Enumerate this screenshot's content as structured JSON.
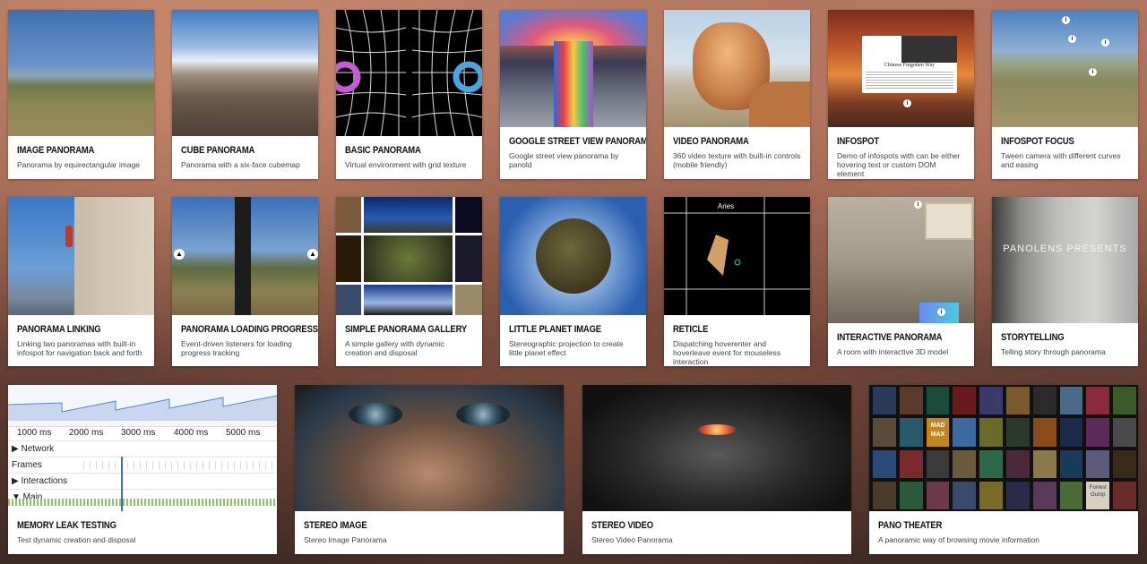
{
  "cards": [
    {
      "title": "IMAGE PANORAMA",
      "desc": "Panorama by equirectangular image"
    },
    {
      "title": "CUBE PANORAMA",
      "desc": "Panorama with a six-face cubemap"
    },
    {
      "title": "BASIC PANORAMA",
      "desc": "Virtual environment with grid texture"
    },
    {
      "title": "GOOGLE STREET VIEW PANORAMA",
      "desc": "Google street view panorama by panold"
    },
    {
      "title": "VIDEO PANORAMA",
      "desc": "360 video texture with built-in controls (mobile friendly)"
    },
    {
      "title": "INFOSPOT",
      "desc": "Demo of infospots with can be either hovering text or custom DOM element"
    },
    {
      "title": "INFOSPOT FOCUS",
      "desc": "Tween camera with different curves and easing"
    },
    {
      "title": "PANORAMA LINKING",
      "desc": "Linking two panoramas with built-in infospot for navigation back and forth"
    },
    {
      "title": "PANORAMA LOADING PROGRESS",
      "desc": "Event-driven listeners for loading progress tracking"
    },
    {
      "title": "SIMPLE PANORAMA GALLERY",
      "desc": "A simple gallery with dynamic creation and disposal"
    },
    {
      "title": "LITTLE PLANET IMAGE",
      "desc": "Stereographic projection to create little planet effect"
    },
    {
      "title": "RETICLE",
      "desc": "Dispatching hoverenter and hoverleave event for mouseless interaction"
    },
    {
      "title": "INTERACTIVE PANORAMA",
      "desc": "A room with interactive 3D model"
    },
    {
      "title": "STORYTELLING",
      "desc": "Telling story through panorama"
    },
    {
      "title": "MEMORY LEAK TESTING",
      "desc": "Test dynamic creation and disposal"
    },
    {
      "title": "STEREO IMAGE",
      "desc": "Stereo Image Panorama"
    },
    {
      "title": "STEREO VIDEO",
      "desc": "Stereo Video Panorama"
    },
    {
      "title": "PANO THEATER",
      "desc": "A panoramic way of browsing movie information"
    }
  ],
  "thumb_text": {
    "infospot_heading": "Chinese Forgotten Way",
    "reticle_label": "Aries",
    "storytelling_overlay": "PANOLENS PRESENTS",
    "poster_label": "MAD MAX",
    "poster_label_2": "Forrest Gump"
  },
  "perf": {
    "ticks": [
      "1000 ms",
      "2000 ms",
      "3000 ms",
      "4000 ms",
      "5000 ms"
    ],
    "rows": [
      "▶ Network",
      "Frames",
      "▶ Interactions",
      "▼ Main"
    ]
  }
}
